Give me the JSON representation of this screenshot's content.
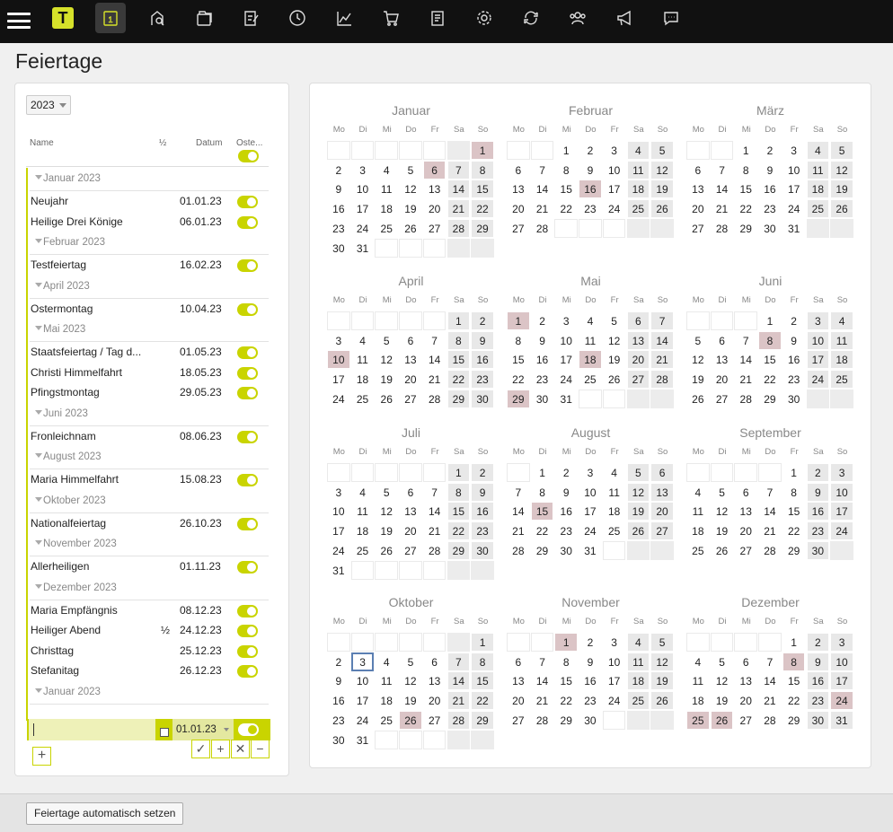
{
  "topbar": {
    "logo": "T",
    "icons": [
      "menu-icon",
      "logo-icon",
      "calendar-icon",
      "location-icon",
      "folders-icon",
      "checklist-icon",
      "clock-icon",
      "chart-icon",
      "cart-icon",
      "documents-icon",
      "gear-icon",
      "sync-icon",
      "users-icon",
      "megaphone-icon",
      "chat-icon"
    ],
    "active_icon": "calendar-icon",
    "accent": "#d6e12a"
  },
  "page": {
    "title": "Feiertage"
  },
  "left": {
    "year": "2023",
    "columns": {
      "name": "Name",
      "half": "½",
      "date": "Datum",
      "easter": "Oste..."
    },
    "groups": [
      {
        "label": "Januar 2023",
        "rows": [
          {
            "name": "Neujahr",
            "half": "",
            "date": "01.01.23",
            "on": true
          },
          {
            "name": "Heilige Drei Könige",
            "half": "",
            "date": "06.01.23",
            "on": true
          }
        ]
      },
      {
        "label": "Februar 2023",
        "rows": [
          {
            "name": "Testfeiertag",
            "half": "",
            "date": "16.02.23",
            "on": true
          }
        ]
      },
      {
        "label": "April 2023",
        "rows": [
          {
            "name": "Ostermontag",
            "half": "",
            "date": "10.04.23",
            "on": true
          }
        ]
      },
      {
        "label": "Mai 2023",
        "rows": [
          {
            "name": "Staatsfeiertag / Tag d...",
            "half": "",
            "date": "01.05.23",
            "on": true
          },
          {
            "name": "Christi Himmelfahrt",
            "half": "",
            "date": "18.05.23",
            "on": true
          },
          {
            "name": "Pfingstmontag",
            "half": "",
            "date": "29.05.23",
            "on": true
          }
        ]
      },
      {
        "label": "Juni 2023",
        "rows": [
          {
            "name": "Fronleichnam",
            "half": "",
            "date": "08.06.23",
            "on": true
          }
        ]
      },
      {
        "label": "August 2023",
        "rows": [
          {
            "name": "Maria Himmelfahrt",
            "half": "",
            "date": "15.08.23",
            "on": true
          }
        ]
      },
      {
        "label": "Oktober 2023",
        "rows": [
          {
            "name": "Nationalfeiertag",
            "half": "",
            "date": "26.10.23",
            "on": true
          }
        ]
      },
      {
        "label": "November 2023",
        "rows": [
          {
            "name": "Allerheiligen",
            "half": "",
            "date": "01.11.23",
            "on": true
          }
        ]
      },
      {
        "label": "Dezember 2023",
        "rows": [
          {
            "name": "Maria Empfängnis",
            "half": "",
            "date": "08.12.23",
            "on": true
          },
          {
            "name": "Heiliger Abend",
            "half": "½",
            "date": "24.12.23",
            "on": true
          },
          {
            "name": "Christtag",
            "half": "",
            "date": "25.12.23",
            "on": true
          },
          {
            "name": "Stefanitag",
            "half": "",
            "date": "26.12.23",
            "on": true
          }
        ]
      },
      {
        "label": "Januar 2023",
        "rows": []
      }
    ],
    "new_row": {
      "name": "",
      "date": "01.01.23"
    },
    "actions": {
      "confirm": "✓",
      "add": "+",
      "cancel": "✕",
      "remove": "−"
    },
    "add_button": "+"
  },
  "calendar": {
    "weekdays": [
      "Mo",
      "Di",
      "Mi",
      "Do",
      "Fr",
      "Sa",
      "So"
    ],
    "months": [
      {
        "name": "Januar",
        "offset": 6,
        "days": 31,
        "holidays": [
          1,
          6
        ],
        "today": null
      },
      {
        "name": "Februar",
        "offset": 2,
        "days": 28,
        "holidays": [
          16
        ],
        "today": null
      },
      {
        "name": "März",
        "offset": 2,
        "days": 31,
        "holidays": [],
        "today": null
      },
      {
        "name": "April",
        "offset": 5,
        "days": 30,
        "holidays": [
          10
        ],
        "today": null
      },
      {
        "name": "Mai",
        "offset": 0,
        "days": 31,
        "holidays": [
          1,
          18,
          29
        ],
        "today": null
      },
      {
        "name": "Juni",
        "offset": 3,
        "days": 30,
        "holidays": [
          8
        ],
        "today": null
      },
      {
        "name": "Juli",
        "offset": 5,
        "days": 31,
        "holidays": [],
        "today": null
      },
      {
        "name": "August",
        "offset": 1,
        "days": 31,
        "holidays": [
          15
        ],
        "today": null
      },
      {
        "name": "September",
        "offset": 4,
        "days": 30,
        "holidays": [],
        "today": null
      },
      {
        "name": "Oktober",
        "offset": 6,
        "days": 31,
        "holidays": [
          26
        ],
        "today": 3
      },
      {
        "name": "November",
        "offset": 2,
        "days": 30,
        "holidays": [
          1
        ],
        "today": null
      },
      {
        "name": "Dezember",
        "offset": 4,
        "days": 31,
        "holidays": [
          8,
          24,
          25,
          26
        ],
        "today": null
      }
    ],
    "holiday_color": "#dbc4c6",
    "weekend_color": "#e8e8e8"
  },
  "bottom": {
    "auto_button": "Feiertage automatisch setzen"
  }
}
